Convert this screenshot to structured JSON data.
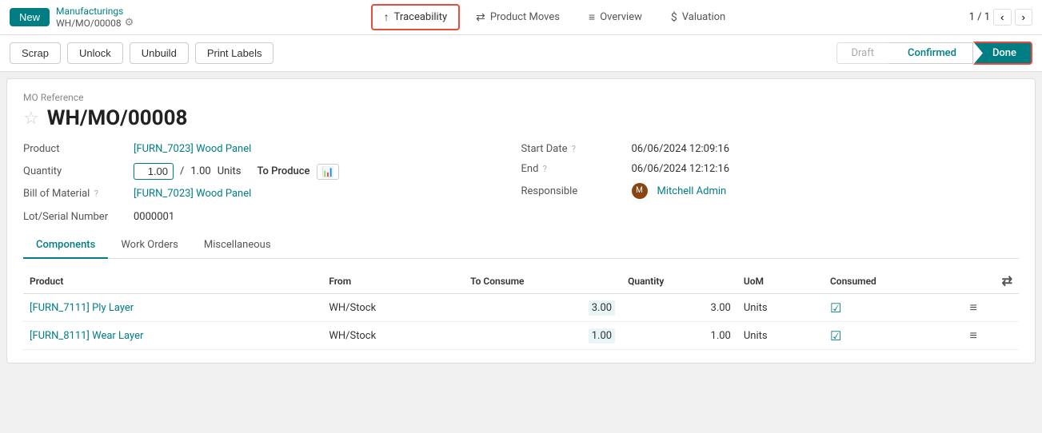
{
  "topbar": {
    "new_label": "New",
    "breadcrumb_parent": "Manufacturings",
    "breadcrumb_current": "WH/MO/00008",
    "pagination": "1 / 1",
    "tabs": [
      {
        "id": "traceability",
        "label": "Traceability",
        "icon": "↑",
        "active": true
      },
      {
        "id": "product_moves",
        "label": "Product Moves",
        "icon": "⇄",
        "active": false
      },
      {
        "id": "overview",
        "label": "Overview",
        "icon": "≡",
        "active": false
      },
      {
        "id": "valuation",
        "label": "Valuation",
        "icon": "$",
        "active": false
      }
    ]
  },
  "actionbar": {
    "buttons": [
      "Scrap",
      "Unlock",
      "Unbuild",
      "Print Labels"
    ],
    "status": {
      "draft": "Draft",
      "confirmed": "Confirmed",
      "done": "Done"
    }
  },
  "form": {
    "mo_ref_label": "MO Reference",
    "mo_number": "WH/MO/00008",
    "product_label": "Product",
    "product_value": "[FURN_7023] Wood Panel",
    "quantity_label": "Quantity",
    "quantity_value": "1.00",
    "quantity_total": "1.00",
    "units_label": "Units",
    "to_produce_label": "To Produce",
    "bom_label": "Bill of Material",
    "bom_value": "[FURN_7023] Wood Panel",
    "lot_label": "Lot/Serial Number",
    "lot_value": "0000001",
    "start_date_label": "Start Date",
    "start_date_help": "?",
    "start_date_value": "06/06/2024 12:09:16",
    "end_label": "End",
    "end_help": "?",
    "end_value": "06/06/2024 12:12:16",
    "responsible_label": "Responsible",
    "responsible_value": "Mitchell Admin"
  },
  "tabs": {
    "components_label": "Components",
    "work_orders_label": "Work Orders",
    "miscellaneous_label": "Miscellaneous"
  },
  "table": {
    "headers": {
      "product": "Product",
      "from": "From",
      "to_consume": "To Consume",
      "quantity": "Quantity",
      "uom": "UoM",
      "consumed": "Consumed"
    },
    "rows": [
      {
        "product": "[FURN_7111] Ply Layer",
        "from": "WH/Stock",
        "to_consume": "3.00",
        "quantity": "3.00",
        "uom": "Units",
        "consumed": true
      },
      {
        "product": "[FURN_8111] Wear Layer",
        "from": "WH/Stock",
        "to_consume": "1.00",
        "quantity": "1.00",
        "uom": "Units",
        "consumed": true
      }
    ]
  },
  "colors": {
    "teal": "#017e84",
    "red_border": "#e74c3c",
    "checkbox_teal": "#017e84"
  }
}
